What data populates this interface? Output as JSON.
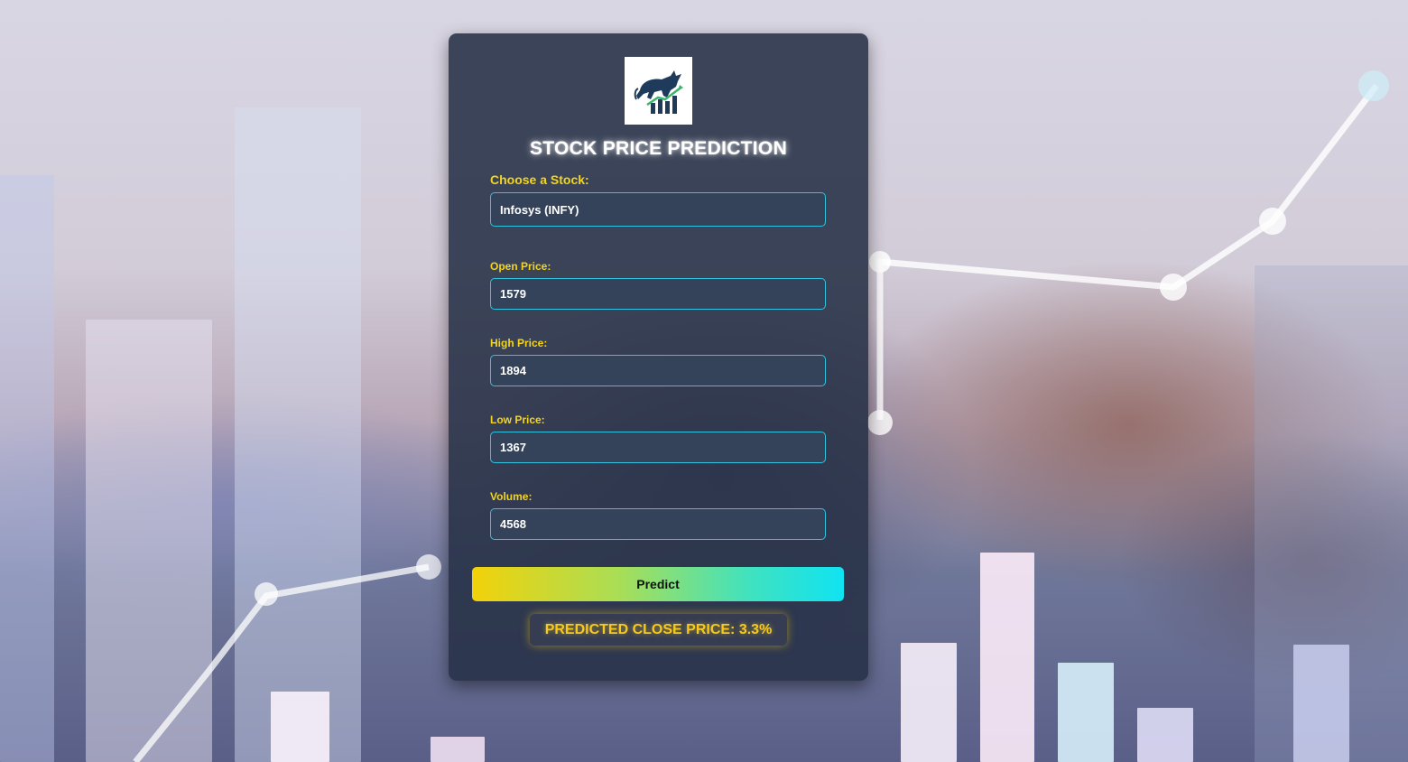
{
  "app": {
    "title": "STOCK PRICE PREDICTION",
    "logo_icon": "bull-chart-icon"
  },
  "form": {
    "stock": {
      "label": "Choose a Stock:",
      "value": "Infosys (INFY)"
    },
    "open": {
      "label": "Open Price:",
      "value": "1579"
    },
    "high": {
      "label": "High Price:",
      "value": "1894"
    },
    "low": {
      "label": "Low Price:",
      "value": "1367"
    },
    "volume": {
      "label": "Volume:",
      "value": "4568"
    },
    "predict_label": "Predict"
  },
  "result": {
    "text": "PREDICTED CLOSE PRICE: 3.3%"
  },
  "colors": {
    "accent_label": "#f3d51b",
    "field_border": "#31c4e0",
    "result_text": "#f6c91c",
    "card_bg": "#263046"
  }
}
